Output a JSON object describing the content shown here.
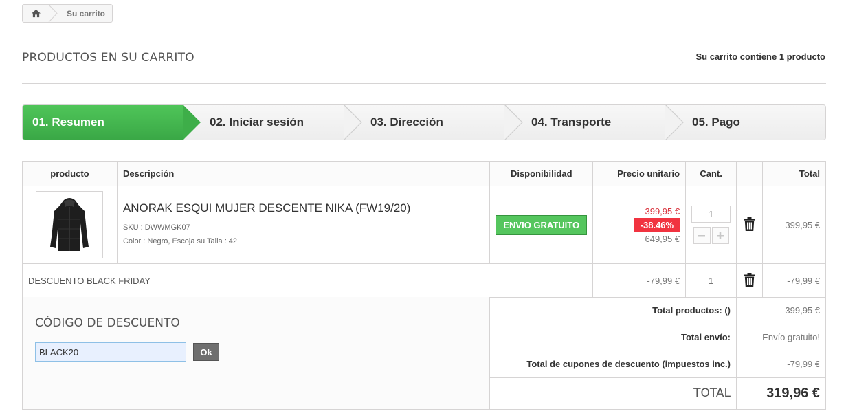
{
  "breadcrumb": {
    "home_icon": "home-icon",
    "current": "Su carrito"
  },
  "heading": {
    "title": "PRODUCTOS EN SU CARRITO",
    "count_text": "Su carrito contiene 1 producto"
  },
  "steps": [
    {
      "label": "01. Resumen",
      "active": true
    },
    {
      "label": "02. Iniciar sesión",
      "active": false
    },
    {
      "label": "03. Dirección",
      "active": false
    },
    {
      "label": "04. Transporte",
      "active": false
    },
    {
      "label": "05. Pago",
      "active": false
    }
  ],
  "table": {
    "headers": {
      "product": "producto",
      "description": "Descripción",
      "availability": "Disponibilidad",
      "unit_price": "Precio unitario",
      "qty": "Cant.",
      "total": "Total"
    },
    "item": {
      "name": "ANORAK ESQUI MUJER DESCENTE NIKA (FW19/20)",
      "sku": "SKU : DWWMGK07",
      "attributes": "Color : Negro, Escoja su Talla : 42",
      "availability_badge": "ENVIO GRATUITO",
      "price_new": "399,95 €",
      "discount_pct": "-38.46%",
      "price_old": "649,95 €",
      "qty": "1",
      "total": "399,95 €"
    },
    "discount_line": {
      "name": "DESCUENTO BLACK FRIDAY",
      "unit_price": "-79,99 €",
      "qty": "1",
      "total": "-79,99 €"
    }
  },
  "voucher": {
    "title": "CÓDIGO DE DESCUENTO",
    "value": "BLACK20",
    "button": "Ok"
  },
  "totals": {
    "products_label": "Total productos: ()",
    "products_value": "399,95 €",
    "shipping_label": "Total envío:",
    "shipping_value": "Envío gratuito!",
    "coupons_label": "Total de cupones de descuento (impuestos inc.)",
    "coupons_value": "-79,99 €",
    "grand_label": "TOTAL",
    "grand_value": "319,96 €"
  },
  "colors": {
    "accent_green": "#43b54e",
    "discount_red": "#f13340",
    "price_red": "#d9323c"
  }
}
